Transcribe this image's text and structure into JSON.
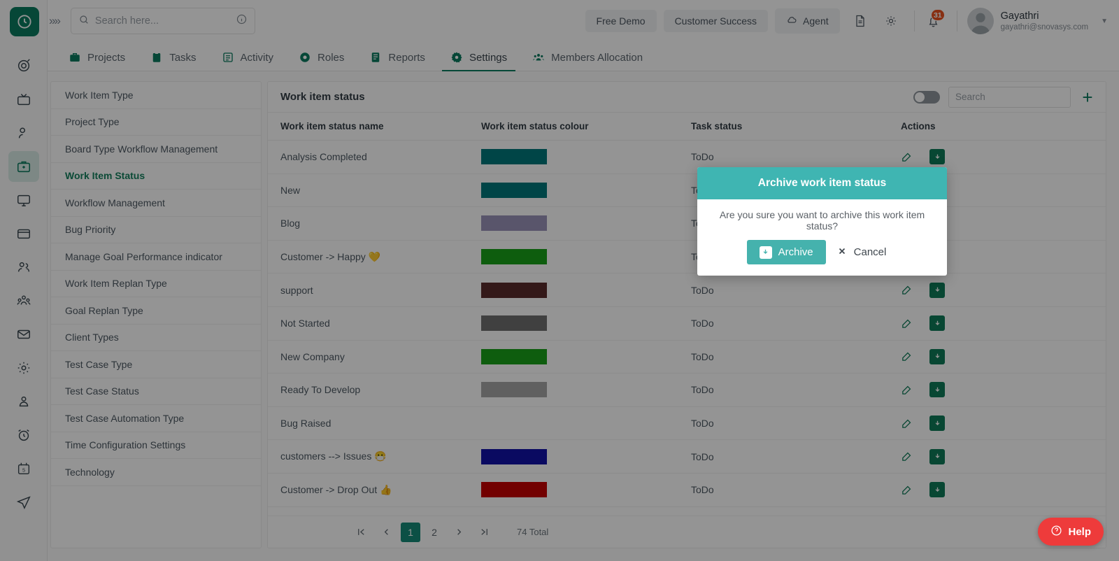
{
  "brand": {
    "logo_icon": "clock-logo-icon",
    "accent": "#0b7a5f",
    "collapse_icon": "chevrons-right-icon"
  },
  "topbar": {
    "search": {
      "placeholder": "Search here...",
      "value": "",
      "icon": "search-icon",
      "info_icon": "info-icon"
    },
    "pills": [
      {
        "label": "Free Demo",
        "icon": null
      },
      {
        "label": "Customer Success",
        "icon": null
      },
      {
        "label": "Agent",
        "icon": "cloud-icon"
      }
    ],
    "doc_icon": "document-icon",
    "gear_icon": "gear-icon",
    "bell_icon": "bell-icon",
    "notification_count": "31",
    "user": {
      "name": "Gayathri",
      "email": "gayathri@snovasys.com",
      "avatar": "avatar",
      "caret": "chevron-down-icon"
    }
  },
  "nav_tabs": [
    {
      "label": "Projects",
      "icon": "briefcase-icon",
      "active": false
    },
    {
      "label": "Tasks",
      "icon": "clipboard-icon",
      "active": false
    },
    {
      "label": "Activity",
      "icon": "list-icon",
      "active": false
    },
    {
      "label": "Roles",
      "icon": "gear-icon",
      "active": false
    },
    {
      "label": "Reports",
      "icon": "report-icon",
      "active": false
    },
    {
      "label": "Settings",
      "icon": "settings-gear-icon",
      "active": true
    },
    {
      "label": "Members Allocation",
      "icon": "people-icon",
      "active": false
    }
  ],
  "rail_items": [
    {
      "icon": "target-icon",
      "active": false
    },
    {
      "icon": "tv-icon",
      "active": false
    },
    {
      "icon": "user-icon",
      "active": false
    },
    {
      "icon": "briefcase-icon",
      "active": true
    },
    {
      "icon": "monitor-icon",
      "active": false
    },
    {
      "icon": "card-icon",
      "active": false
    },
    {
      "icon": "users-icon",
      "active": false
    },
    {
      "icon": "team-icon",
      "active": false
    },
    {
      "icon": "mail-icon",
      "active": false
    },
    {
      "icon": "gear-icon",
      "active": false
    },
    {
      "icon": "user-badge-icon",
      "active": false
    },
    {
      "icon": "alarm-clock-icon",
      "active": false
    },
    {
      "icon": "calendar-5-icon",
      "active": false
    },
    {
      "icon": "send-icon",
      "active": false
    }
  ],
  "settings_menu": [
    {
      "label": "Work Item Type",
      "active": false
    },
    {
      "label": "Project Type",
      "active": false
    },
    {
      "label": "Board Type Workflow Management",
      "active": false
    },
    {
      "label": "Work Item Status",
      "active": true
    },
    {
      "label": "Workflow Management",
      "active": false
    },
    {
      "label": "Bug Priority",
      "active": false
    },
    {
      "label": "Manage Goal Performance indicator",
      "active": false
    },
    {
      "label": "Work Item Replan Type",
      "active": false
    },
    {
      "label": "Goal Replan Type",
      "active": false
    },
    {
      "label": "Client Types",
      "active": false
    },
    {
      "label": "Test Case Type",
      "active": false
    },
    {
      "label": "Test Case Status",
      "active": false
    },
    {
      "label": "Test Case Automation Type",
      "active": false
    },
    {
      "label": "Time Configuration Settings",
      "active": false
    },
    {
      "label": "Technology",
      "active": false
    }
  ],
  "panel": {
    "title": "Work item status",
    "toggle_on": false,
    "search": {
      "placeholder": "Search",
      "value": ""
    },
    "add_label": "+",
    "columns": [
      "Work item status name",
      "Work item status colour",
      "Task status",
      "Actions"
    ],
    "rows": [
      {
        "name": "Analysis Completed",
        "colour": "#00787a",
        "task_status": "ToDo"
      },
      {
        "name": "New",
        "colour": "#00787a",
        "task_status": "ToDo"
      },
      {
        "name": "Blog",
        "colour": "#9a93b8",
        "task_status": "ToDo"
      },
      {
        "name": "Customer -> Happy 💛",
        "colour": "#19a019",
        "task_status": "ToDo"
      },
      {
        "name": "support",
        "colour": "#5b2b2b",
        "task_status": "ToDo"
      },
      {
        "name": "Not Started",
        "colour": "#6e6e6e",
        "task_status": "ToDo"
      },
      {
        "name": "New Company",
        "colour": "#19a019",
        "task_status": "ToDo"
      },
      {
        "name": "Ready To Develop",
        "colour": "#a6a6a6",
        "task_status": "ToDo"
      },
      {
        "name": "Bug Raised",
        "colour": "",
        "task_status": "ToDo"
      },
      {
        "name": "customers --> Issues 😷",
        "colour": "#1212a8",
        "task_status": "ToDo"
      },
      {
        "name": "Customer -> Drop Out 👍",
        "colour": "#c40000",
        "task_status": "ToDo"
      }
    ],
    "row_actions": {
      "edit_icon": "edit-pencil-icon",
      "archive_icon": "archive-box-icon"
    },
    "pagination": {
      "first_icon": "first-page-icon",
      "prev_icon": "prev-page-icon",
      "pages": [
        "1",
        "2"
      ],
      "current": "1",
      "next_icon": "next-page-icon",
      "last_icon": "last-page-icon",
      "total_label": "74 Total"
    }
  },
  "modal": {
    "title": "Archive work item status",
    "message": "Are you sure you want to archive this work item status?",
    "confirm_label": "Archive",
    "confirm_icon": "archive-box-icon",
    "cancel_label": "Cancel",
    "cancel_icon": "close-x-icon",
    "header_color": "#3fb5b2"
  },
  "help": {
    "label": "Help",
    "icon": "question-circle-icon",
    "color": "#ee3b3b"
  }
}
